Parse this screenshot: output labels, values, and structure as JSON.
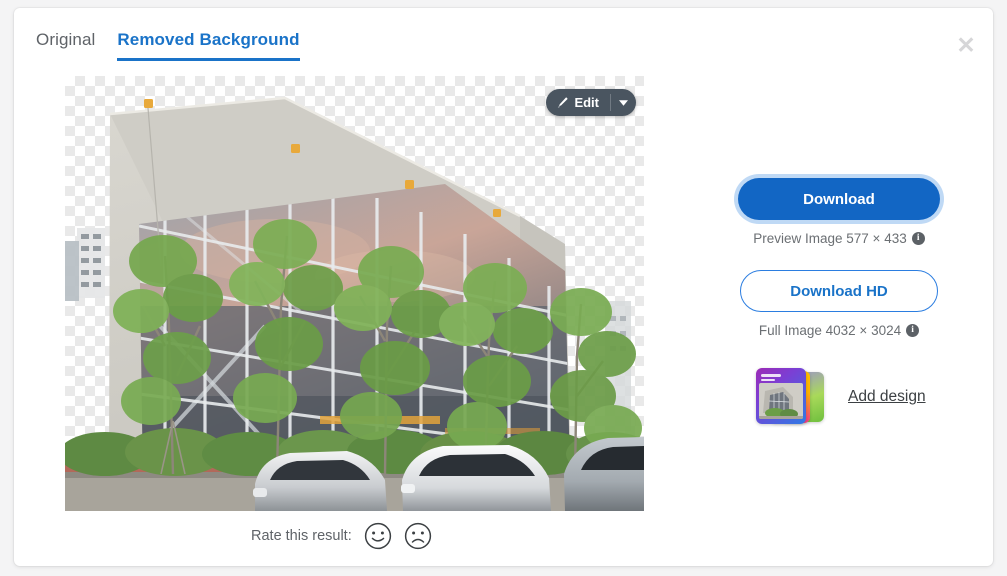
{
  "window": {
    "close_label": "✕"
  },
  "tabs": [
    {
      "label": "Original",
      "active": false
    },
    {
      "label": "Removed Background",
      "active": true
    }
  ],
  "preview": {
    "edit_button": {
      "label": "Edit",
      "icon": "brush-icon",
      "caret": "▾"
    },
    "image_alt": "Modern glass-facade building with trees and parked cars, background removed"
  },
  "rating": {
    "label": "Rate this result:",
    "positive_icon": "smiley-face-icon",
    "negative_icon": "frowning-face-icon"
  },
  "actions": {
    "download": {
      "label": "Download",
      "caption": "Preview Image 577 × 433",
      "info_icon": "i"
    },
    "download_hd": {
      "label": "Download HD",
      "caption": "Full Image 4032 × 3024",
      "info_icon": "i"
    },
    "add_design": {
      "label": "Add design",
      "thumbnail": "design-templates-thumbnail"
    }
  },
  "colors": {
    "primary_blue": "#1266c4",
    "link_blue": "#1a73c8",
    "focus_ring": "#bfd9f5",
    "text_gray": "#5f6368",
    "edit_pill": "#4a5560"
  }
}
